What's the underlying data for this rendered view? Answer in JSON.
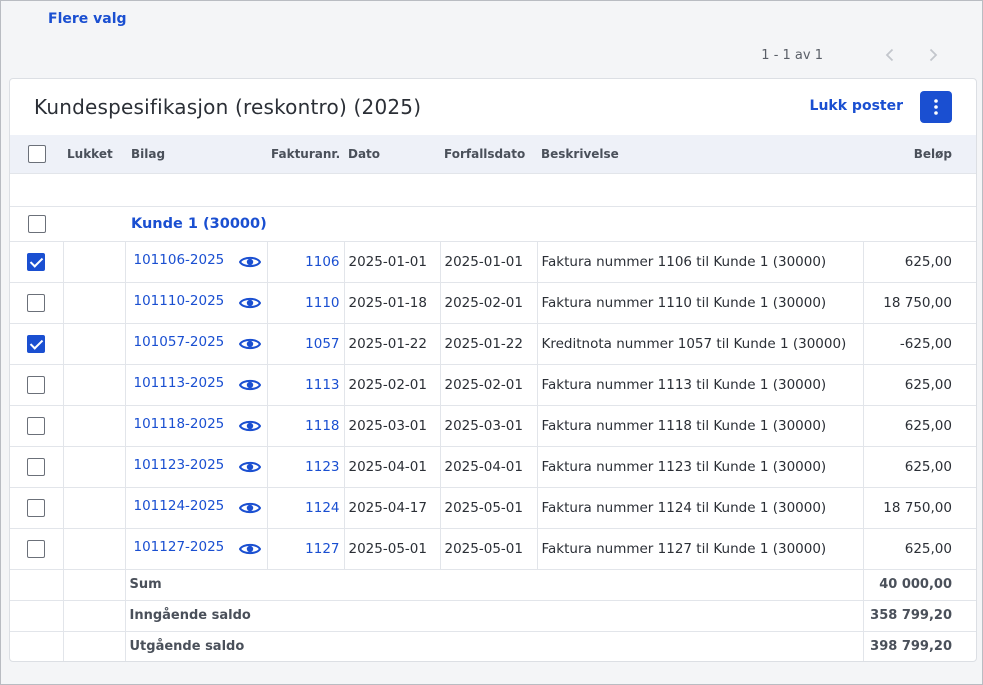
{
  "top_link": "Flere valg",
  "pagination": {
    "range_text": "1 - 1 av 1"
  },
  "card": {
    "title": "Kundespesifikasjon (reskontro) (2025)",
    "close_button": "Lukk poster"
  },
  "table": {
    "headers": {
      "closed": "Lukket",
      "voucher": "Bilag",
      "invoice_no": "Fakturanr.",
      "date": "Dato",
      "due_date": "Forfallsdato",
      "description": "Beskrivelse",
      "amount": "Beløp"
    },
    "group_label": "Kunde 1 (30000)",
    "rows": [
      {
        "checked": true,
        "voucher": "101106-2025",
        "invoice": "1106",
        "date": "2025-01-01",
        "due": "2025-01-01",
        "desc": "Faktura nummer 1106 til Kunde 1 (30000)",
        "amount": "625,00"
      },
      {
        "checked": false,
        "voucher": "101110-2025",
        "invoice": "1110",
        "date": "2025-01-18",
        "due": "2025-02-01",
        "desc": "Faktura nummer 1110 til Kunde 1 (30000)",
        "amount": "18 750,00"
      },
      {
        "checked": true,
        "voucher": "101057-2025",
        "invoice": "1057",
        "date": "2025-01-22",
        "due": "2025-01-22",
        "desc": "Kreditnota nummer 1057 til Kunde 1 (30000)",
        "amount": "-625,00"
      },
      {
        "checked": false,
        "voucher": "101113-2025",
        "invoice": "1113",
        "date": "2025-02-01",
        "due": "2025-02-01",
        "desc": "Faktura nummer 1113 til Kunde 1 (30000)",
        "amount": "625,00"
      },
      {
        "checked": false,
        "voucher": "101118-2025",
        "invoice": "1118",
        "date": "2025-03-01",
        "due": "2025-03-01",
        "desc": "Faktura nummer 1118 til Kunde 1 (30000)",
        "amount": "625,00"
      },
      {
        "checked": false,
        "voucher": "101123-2025",
        "invoice": "1123",
        "date": "2025-04-01",
        "due": "2025-04-01",
        "desc": "Faktura nummer 1123 til Kunde 1 (30000)",
        "amount": "625,00"
      },
      {
        "checked": false,
        "voucher": "101124-2025",
        "invoice": "1124",
        "date": "2025-04-17",
        "due": "2025-05-01",
        "desc": "Faktura nummer 1124 til Kunde 1 (30000)",
        "amount": "18 750,00"
      },
      {
        "checked": false,
        "voucher": "101127-2025",
        "invoice": "1127",
        "date": "2025-05-01",
        "due": "2025-05-01",
        "desc": "Faktura nummer 1127 til Kunde 1 (30000)",
        "amount": "625,00"
      }
    ],
    "totals": [
      {
        "label": "Sum",
        "value": "40 000,00"
      },
      {
        "label": "Inngående saldo",
        "value": "358 799,20"
      },
      {
        "label": "Utgående saldo",
        "value": "398 799,20"
      }
    ]
  },
  "icons": {
    "row_action": "eye-icon",
    "menu": "kebab-icon",
    "prev": "chevron-left-icon",
    "next": "chevron-right-icon"
  },
  "colors": {
    "accent": "#1a4fd1",
    "header_bg": "#eef1f8"
  }
}
